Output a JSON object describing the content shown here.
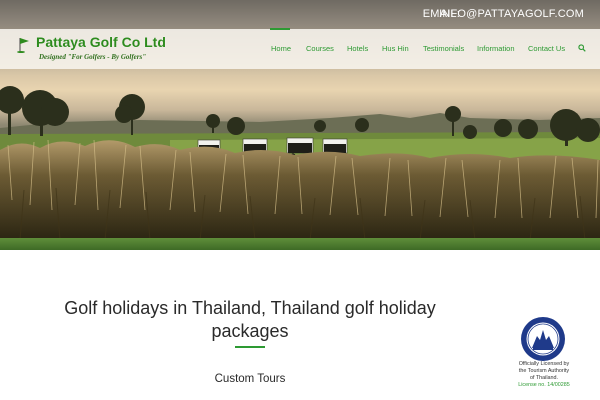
{
  "topbar": {
    "email_label": "EMAIL:",
    "email_value": "INFO@PATTAYAGOLF.COM"
  },
  "logo": {
    "name": "Pattaya Golf Co Ltd",
    "tagline": "Designed \"For Golfers - By Golfers\""
  },
  "nav": {
    "items": [
      {
        "label": "Home",
        "active": true
      },
      {
        "label": "Courses",
        "active": false
      },
      {
        "label": "Hotels",
        "active": false
      },
      {
        "label": "Hus Hin",
        "active": false
      },
      {
        "label": "Testimonials",
        "active": false
      },
      {
        "label": "Information",
        "active": false
      },
      {
        "label": "Contact Us",
        "active": false
      }
    ],
    "search_icon": "search-icon"
  },
  "main": {
    "headline": "Golf holidays in Thailand, Thailand golf holiday packages",
    "subheading": "Custom Tours"
  },
  "license": {
    "line1": "Officially Licensed by",
    "line2": "the Tourism Authority",
    "line3": "of Thailand.",
    "number": "License no. 14/00285"
  },
  "colors": {
    "accent": "#2d9a33",
    "logo_green": "#2e8b1e",
    "text": "#2a2a2a",
    "seal_blue": "#1f3a8a"
  }
}
